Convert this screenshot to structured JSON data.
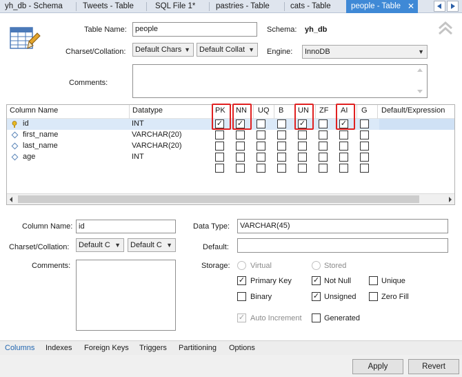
{
  "tabs": [
    {
      "label": "yh_db - Schema"
    },
    {
      "label": "Tweets - Table"
    },
    {
      "label": "SQL File 1*"
    },
    {
      "label": "pastries - Table"
    },
    {
      "label": "cats - Table"
    },
    {
      "label": "people - Table"
    }
  ],
  "tab_close_glyph": "✕",
  "header": {
    "table_name_label": "Table Name:",
    "table_name_value": "people",
    "schema_label": "Schema:",
    "schema_value": "yh_db",
    "charset_label": "Charset/Collation:",
    "charset_value": "Default Chars",
    "collation_value": "Default Collat",
    "engine_label": "Engine:",
    "engine_value": "InnoDB",
    "comments_label": "Comments:",
    "comments_value": ""
  },
  "grid": {
    "columns": [
      "Column Name",
      "Datatype",
      "PK",
      "NN",
      "UQ",
      "B",
      "UN",
      "ZF",
      "AI",
      "G",
      "Default/Expression"
    ],
    "rows": [
      {
        "name": "id",
        "type": "INT",
        "flags": [
          true,
          true,
          false,
          false,
          true,
          false,
          true,
          false
        ]
      },
      {
        "name": "first_name",
        "type": "VARCHAR(20)",
        "flags": [
          false,
          false,
          false,
          false,
          false,
          false,
          false,
          false
        ]
      },
      {
        "name": "last_name",
        "type": "VARCHAR(20)",
        "flags": [
          false,
          false,
          false,
          false,
          false,
          false,
          false,
          false
        ]
      },
      {
        "name": "age",
        "type": "INT",
        "flags": [
          false,
          false,
          false,
          false,
          false,
          false,
          false,
          false
        ]
      },
      {
        "name": "",
        "type": "",
        "flags": [
          false,
          false,
          false,
          false,
          false,
          false,
          false,
          false
        ]
      }
    ]
  },
  "detail": {
    "column_name_label": "Column Name:",
    "column_name_value": "id",
    "data_type_label": "Data Type:",
    "data_type_value": "VARCHAR(45)",
    "charset_label": "Charset/Collation:",
    "charset_value": "Default C",
    "collation_value": "Default C",
    "default_label": "Default:",
    "default_value": "",
    "comments_label": "Comments:",
    "storage_label": "Storage:",
    "virtual_label": "Virtual",
    "stored_label": "Stored",
    "primary_key_label": "Primary Key",
    "not_null_label": "Not Null",
    "unique_label": "Unique",
    "binary_label": "Binary",
    "unsigned_label": "Unsigned",
    "zero_fill_label": "Zero Fill",
    "auto_increment_label": "Auto Increment",
    "generated_label": "Generated",
    "primary_key_checked": true,
    "not_null_checked": true,
    "unique_checked": false,
    "binary_checked": false,
    "unsigned_checked": true,
    "zero_fill_checked": false,
    "auto_increment_checked": true,
    "generated_checked": false
  },
  "bottom_tabs": [
    "Columns",
    "Indexes",
    "Foreign Keys",
    "Triggers",
    "Partitioning",
    "Options"
  ],
  "buttons": {
    "apply": "Apply",
    "revert": "Revert"
  },
  "icons": {
    "check": "✓",
    "dropdown": "▼",
    "nav_left": "◀",
    "nav_right": "▶"
  },
  "colors": {
    "active_tab": "#3f89d6",
    "highlight": "#e02020",
    "selected_row": "#dbe9f8"
  }
}
